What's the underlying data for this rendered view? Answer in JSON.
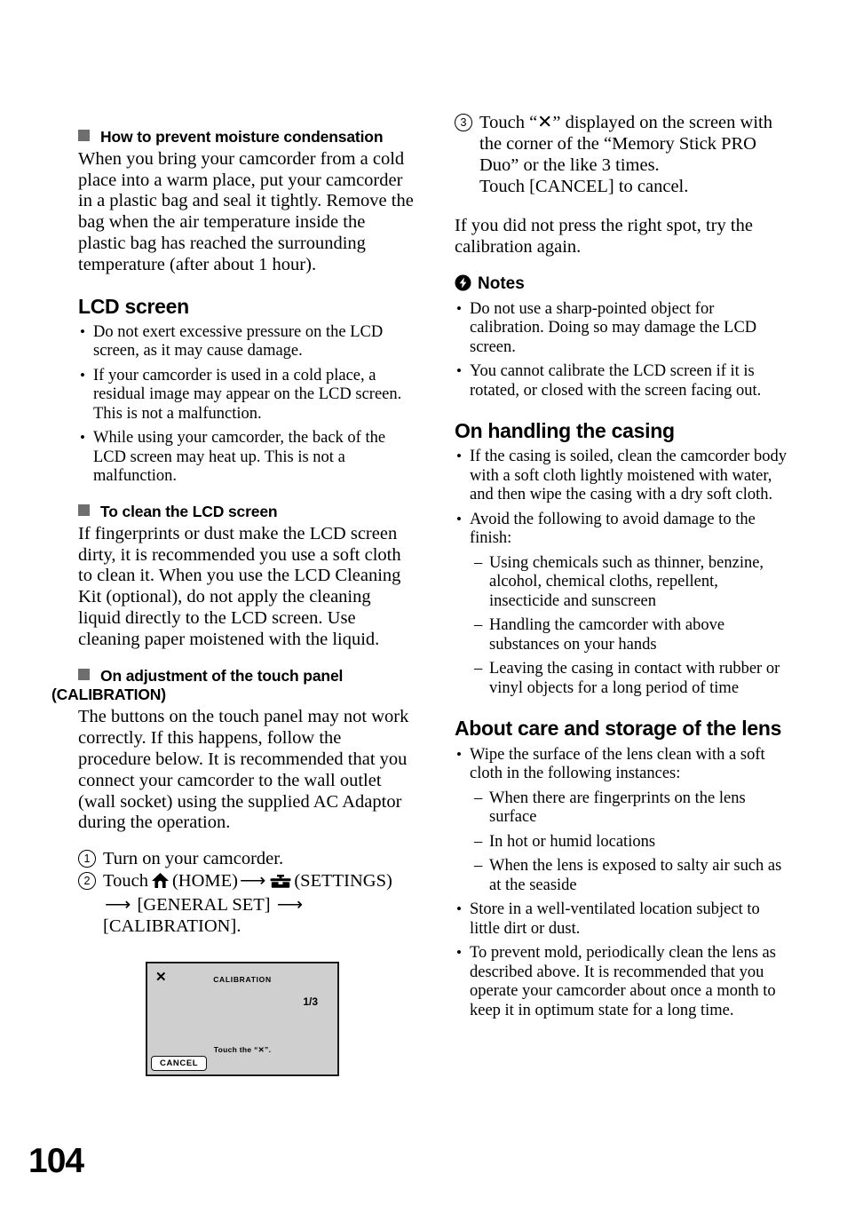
{
  "page": {
    "number": "104",
    "figure_gray": "#cfcfcf",
    "bullet_square_color": "#6e6e6e"
  },
  "left_column": {
    "moisture": {
      "heading": "How to prevent moisture condensation",
      "body": "When you bring your camcorder from a cold place into a warm place, put your camcorder in a plastic bag and seal it tightly. Remove the bag when the air temperature inside the plastic bag has reached the surrounding temperature (after about 1 hour)."
    },
    "lcd_screen": {
      "heading": "LCD screen",
      "bullets": [
        "Do not exert excessive pressure on the LCD screen, as it may cause damage.",
        "If your camcorder is used in a cold place, a residual image may appear on the LCD screen. This is not a malfunction.",
        "While using your camcorder, the back of the LCD screen may heat up. This is not a malfunction."
      ]
    },
    "clean_lcd": {
      "heading": "To clean the LCD screen",
      "body": "If fingerprints or dust make the LCD screen dirty, it is recommended you use a soft cloth to clean it. When you use the LCD Cleaning Kit (optional), do not apply the cleaning liquid directly to the LCD screen. Use cleaning paper moistened with the liquid."
    },
    "calibration": {
      "heading_line1": "On adjustment of the touch panel",
      "heading_line2": "(CALIBRATION)",
      "body": "The buttons on the touch panel may not work correctly. If this happens, follow the procedure below. It is recommended that you connect your camcorder to the wall outlet (wall socket) using the supplied AC Adaptor during the operation.",
      "steps": [
        {
          "number": "1",
          "text": "Turn on your camcorder."
        },
        {
          "number": "2",
          "text_1": "Touch",
          "home_label": "(HOME)",
          "settings_label": "(SETTINGS)",
          "text_2": "[GENERAL SET]",
          "text_3": "[CALIBRATION].",
          "arrow": "⟶"
        }
      ]
    },
    "figure": {
      "close_mark": "✕",
      "title": "CALIBRATION",
      "page_indicator": "1/3",
      "instruction": "Touch the “✕”.",
      "cancel_button": "CANCEL"
    }
  },
  "right_column": {
    "step3": {
      "number": "3",
      "text": "Touch “✕” displayed on the screen with the corner of the “Memory Stick PRO Duo” or the like 3 times.",
      "subtext": "Touch [CANCEL] to cancel."
    },
    "retry_note": "If you did not press the right spot, try the calibration again.",
    "notes": {
      "heading": "Notes",
      "icon": "flash-circle-icon",
      "bullets": [
        "Do not use a sharp-pointed object for calibration. Doing so may damage the LCD screen.",
        "You cannot calibrate the LCD screen if it is rotated, or closed with the screen facing out."
      ]
    },
    "casing": {
      "heading": "On handling the casing",
      "bullets": [
        "If the casing is soiled, clean the camcorder body with a soft cloth lightly moistened with water, and then wipe the casing with a dry soft cloth.",
        "Avoid the following to avoid damage to the finish:"
      ],
      "sub_bullets": [
        "Using chemicals such as thinner, benzine, alcohol, chemical cloths, repellent, insecticide and sunscreen",
        "Handling the camcorder with above substances on your hands",
        "Leaving the casing in contact with rubber or vinyl objects for a long period of time"
      ]
    },
    "lens": {
      "heading": "About care and storage of the lens",
      "bullet_1": "Wipe the surface of the lens clean with a soft cloth in the following instances:",
      "sub_bullets": [
        "When there are fingerprints on the lens surface",
        "In hot or humid locations",
        "When the lens is exposed to salty air such as at the seaside"
      ],
      "bullets_tail": [
        "Store in a well-ventilated location subject to little dirt or dust.",
        "To prevent mold, periodically clean the lens as described above. It is recommended that you operate your camcorder about once a month to keep it in optimum state for a long time."
      ]
    }
  }
}
